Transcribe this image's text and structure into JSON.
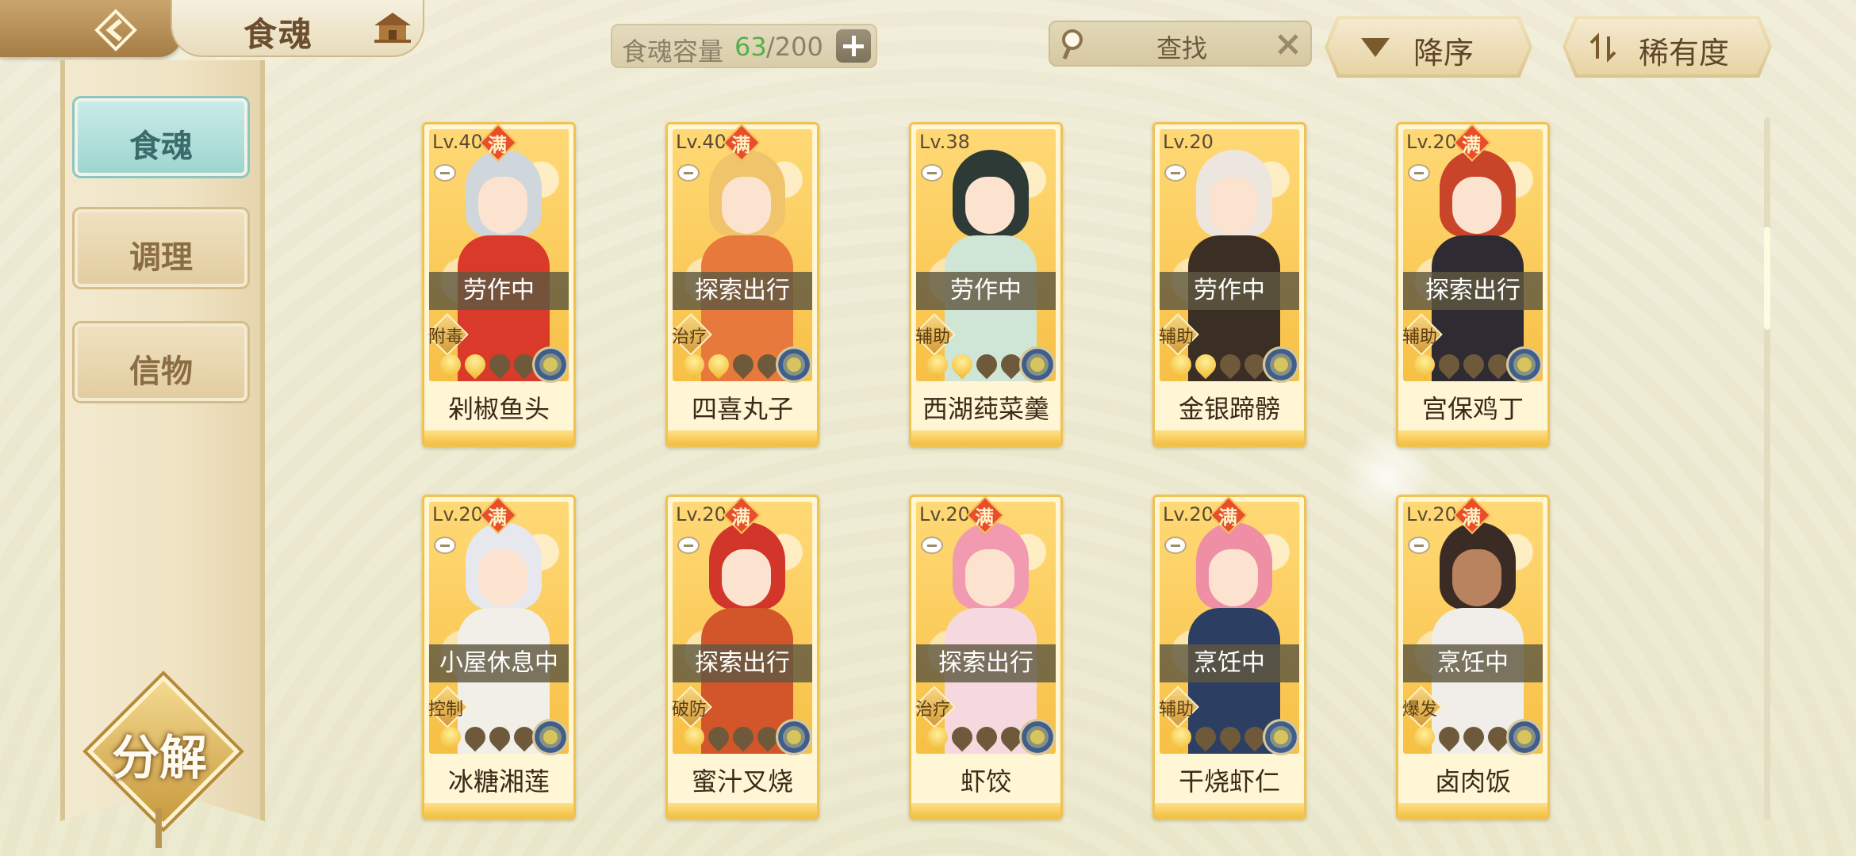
{
  "header": {
    "title": "食魂",
    "capacity": {
      "label": "食魂容量",
      "current": "63",
      "max": "/200"
    },
    "search": {
      "text": "查找"
    },
    "sort_desc_label": "降序",
    "sort_rarity_label": "稀有度"
  },
  "sidebar": {
    "items": [
      {
        "label": "食魂"
      },
      {
        "label": "调理"
      },
      {
        "label": "信物"
      }
    ],
    "decompose_label": "分解"
  },
  "colors": {
    "accent_green": "#55b04a",
    "card_gold": "#f0c252",
    "full_badge": "#e84d2c"
  },
  "cards": [
    {
      "level": "Lv.40",
      "full": "满",
      "status": "劳作中",
      "role": "附毒",
      "stars": 2,
      "name": "剁椒鱼头"
    },
    {
      "level": "Lv.40",
      "full": "满",
      "status": "探索出行",
      "role": "治疗",
      "stars": 2,
      "name": "四喜丸子"
    },
    {
      "level": "Lv.38",
      "full": "",
      "status": "劳作中",
      "role": "辅助",
      "stars": 2,
      "name": "西湖莼菜羹"
    },
    {
      "level": "Lv.20",
      "full": "",
      "status": "劳作中",
      "role": "辅助",
      "stars": 2,
      "name": "金银蹄髈"
    },
    {
      "level": "Lv.20",
      "full": "满",
      "status": "探索出行",
      "role": "辅助",
      "stars": 1,
      "name": "宫保鸡丁"
    },
    {
      "level": "Lv.20",
      "full": "满",
      "status": "小屋休息中",
      "role": "控制",
      "stars": 1,
      "name": "冰糖湘莲"
    },
    {
      "level": "Lv.20",
      "full": "满",
      "status": "探索出行",
      "role": "破防",
      "stars": 1,
      "name": "蜜汁叉烧"
    },
    {
      "level": "Lv.20",
      "full": "满",
      "status": "探索出行",
      "role": "治疗",
      "stars": 1,
      "name": "虾饺"
    },
    {
      "level": "Lv.20",
      "full": "满",
      "status": "烹饪中",
      "role": "辅助",
      "stars": 1,
      "name": "干烧虾仁"
    },
    {
      "level": "Lv.20",
      "full": "满",
      "status": "烹饪中",
      "role": "爆发",
      "stars": 1,
      "name": "卤肉饭"
    }
  ]
}
